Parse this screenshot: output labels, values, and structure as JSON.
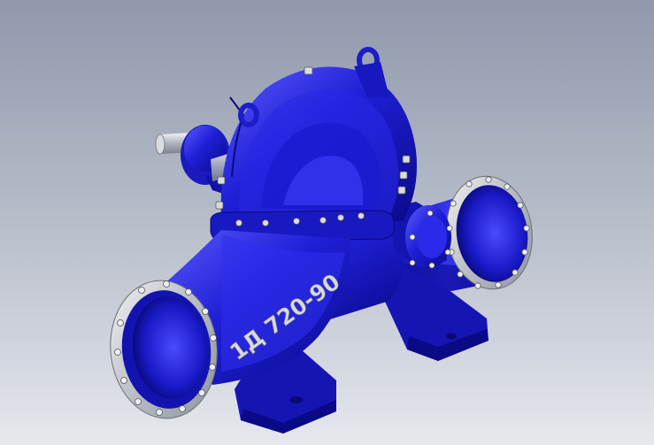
{
  "model": {
    "label": "1Д 720-90",
    "body_color": "#1f1fd6",
    "body_dark": "#0a0a8a",
    "body_light": "#5a5aff",
    "flange_face_color": "#c8cbd1",
    "bolt_color": "#d9dbe0",
    "shaft_color": "#cfd2d8"
  }
}
